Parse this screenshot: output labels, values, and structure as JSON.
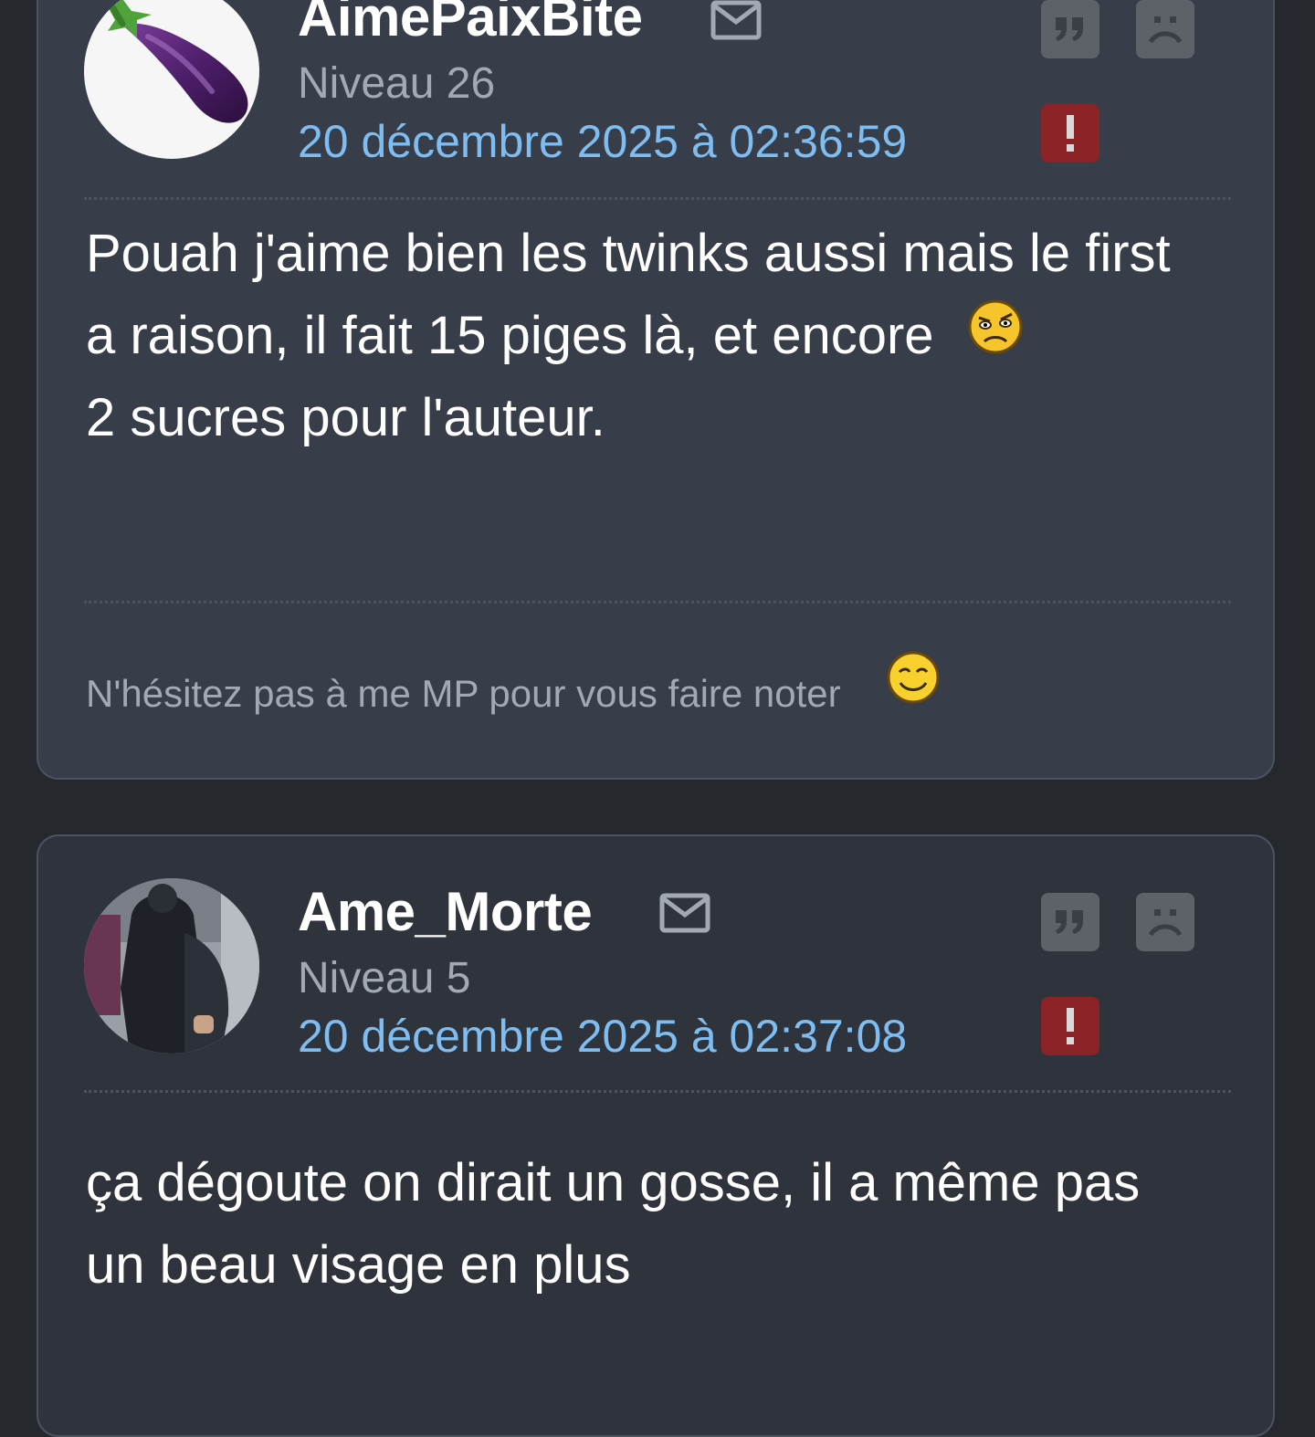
{
  "posts": [
    {
      "username": "AimePaixBite",
      "level": "Niveau 26",
      "date": "20 décembre 2025 à 02:36:59",
      "avatar": "eggplant-avatar",
      "body_lines": [
        "Pouah j'aime bien les twinks aussi mais le first",
        "a raison, il fait 15 piges là, et encore",
        "2 sucres pour l'auteur."
      ],
      "signature": "N'hésitez pas à me MP pour vous faire noter",
      "smileys": [
        "hap-sad-smiley",
        "wink-smiley"
      ]
    },
    {
      "username": "Ame_Morte",
      "level": "Niveau 5",
      "date": "20 décembre 2025 à 02:37:08",
      "avatar": "photo-avatar",
      "body_lines": [
        "ça dégoute on dirait un gosse, il a même pas",
        "un beau visage en plus"
      ]
    }
  ],
  "icons": {
    "mail": "envelope-icon",
    "quote": "quote-icon",
    "sad": "sad-face-icon",
    "report": "exclamation-icon"
  },
  "colors": {
    "background": "#25282d",
    "card": "#373d49",
    "link": "#7fbcf0",
    "report": "#8b2327",
    "button": "#5d6168"
  }
}
